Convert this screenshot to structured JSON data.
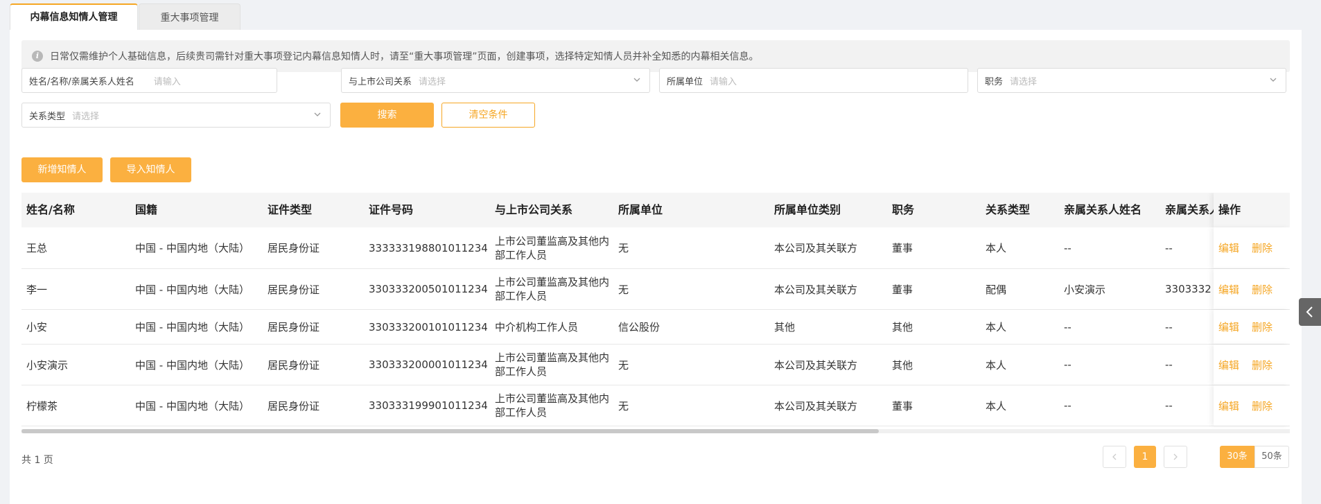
{
  "tabs": [
    {
      "label": "内幕信息知情人管理",
      "active": true
    },
    {
      "label": "重大事项管理",
      "active": false
    }
  ],
  "notice": {
    "icon": "info-icon",
    "text": "日常仅需维护个人基础信息，后续贵司需针对重大事项登记内幕信息知情人时，请至“重大事项管理”页面，创建事项，选择特定知情人员并补全知悉的内幕相关信息。"
  },
  "filters": {
    "name": {
      "label": "姓名/名称/亲属关系人姓名",
      "placeholder": "请输入"
    },
    "relation": {
      "label": "与上市公司关系",
      "placeholder": "请选择"
    },
    "unit": {
      "label": "所属单位",
      "placeholder": "请输入"
    },
    "position": {
      "label": "职务",
      "placeholder": "请选择"
    },
    "relation_type": {
      "label": "关系类型",
      "placeholder": "请选择"
    },
    "search_label": "搜索",
    "clear_label": "清空条件"
  },
  "actions": {
    "add_label": "新增知情人",
    "import_label": "导入知情人"
  },
  "table": {
    "columns": [
      "姓名/名称",
      "国籍",
      "证件类型",
      "证件号码",
      "与上市公司关系",
      "所属单位",
      "所属单位类别",
      "职务",
      "关系类型",
      "亲属关系人姓名",
      "亲属关系人证件号码",
      "操作"
    ],
    "edit_label": "编辑",
    "delete_label": "删除",
    "rows": [
      {
        "name": "王总",
        "nationality": "中国 - 中国内地（大陆）",
        "id_type": "居民身份证",
        "id_no": "333333198801011234",
        "relation": "上市公司董监高及其他内部工作人员",
        "unit": "无",
        "unit_type": "本公司及其关联方",
        "position": "董事",
        "rel_type": "本人",
        "kin_name": "--",
        "kin_id": "--"
      },
      {
        "name": "李一",
        "nationality": "中国 - 中国内地（大陆）",
        "id_type": "居民身份证",
        "id_no": "330333200501011234",
        "relation": "上市公司董监高及其他内部工作人员",
        "unit": "无",
        "unit_type": "本公司及其关联方",
        "position": "董事",
        "rel_type": "配偶",
        "kin_name": "小安演示",
        "kin_id": "3303332"
      },
      {
        "name": "小安",
        "nationality": "中国 - 中国内地（大陆）",
        "id_type": "居民身份证",
        "id_no": "330333200101011234",
        "relation": "中介机构工作人员",
        "unit": "信公股份",
        "unit_type": "其他",
        "position": "其他",
        "rel_type": "本人",
        "kin_name": "--",
        "kin_id": "--"
      },
      {
        "name": "小安演示",
        "nationality": "中国 - 中国内地（大陆）",
        "id_type": "居民身份证",
        "id_no": "330333200001011234",
        "relation": "上市公司董监高及其他内部工作人员",
        "unit": "无",
        "unit_type": "本公司及其关联方",
        "position": "其他",
        "rel_type": "本人",
        "kin_name": "--",
        "kin_id": "--"
      },
      {
        "name": "柠檬茶",
        "nationality": "中国 - 中国内地（大陆）",
        "id_type": "居民身份证",
        "id_no": "330333199901011234",
        "relation": "上市公司董监高及其他内部工作人员",
        "unit": "无",
        "unit_type": "本公司及其关联方",
        "position": "董事",
        "rel_type": "本人",
        "kin_name": "--",
        "kin_id": "--"
      }
    ]
  },
  "pagination": {
    "total_text": "共 1 页",
    "prev_icon": "chevron-left-icon",
    "next_icon": "chevron-right-icon",
    "current_page": "1",
    "sizes": [
      "30条",
      "50条"
    ],
    "active_size": "30条"
  },
  "side_toggle": {
    "icon": "chevron-left-icon"
  },
  "colors": {
    "accent": "#fbb040",
    "accent_text": "#f5a623"
  }
}
